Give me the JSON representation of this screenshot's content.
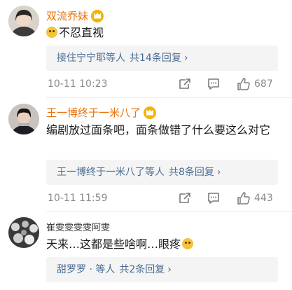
{
  "comments": [
    {
      "username": "双流乔妹",
      "text": "不忍直视",
      "replies_names": "接住宁宁耶等人",
      "replies_total": "共14条回复",
      "timestamp": "10-11 10:23",
      "likes": "687"
    },
    {
      "username": "王一博终于一米八了",
      "text": "编剧放过面条吧，面条做错了什么要这么对它",
      "replies_names": "王一博终于一米八了等人",
      "replies_total": "共8条回复",
      "timestamp": "10-11 11:59",
      "likes": "443"
    },
    {
      "username": "崔雯雯雯雯阿雯",
      "text": "天来…这都是些啥啊…眼疼",
      "replies_names": "甜罗罗 · 等人",
      "replies_total": "共2条回复"
    }
  ],
  "icons": {
    "chevron": "›",
    "share": "share-icon",
    "comment": "comment-icon",
    "like": "thumbs-up-icon"
  },
  "colors": {
    "username_orange": "#e8730c",
    "link_blue": "#4b6d95",
    "vip_gold": "#f6b400",
    "meta_gray": "#8a8a8a"
  }
}
